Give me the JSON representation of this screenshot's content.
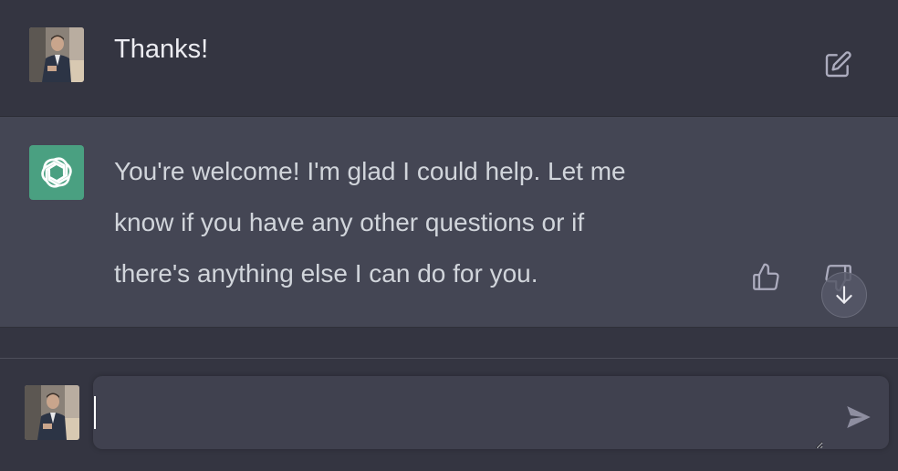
{
  "conversation": {
    "user_message": "Thanks!",
    "assistant_lines": [
      "You're welcome! I'm glad I could help. Let me",
      "know if you have any other questions or if",
      "there's anything else I can do for you."
    ]
  },
  "composer": {
    "value": "",
    "placeholder": ""
  },
  "icons": {
    "edit": "edit-icon",
    "thumbs_up": "thumbs-up-icon",
    "thumbs_down": "thumbs-down-icon",
    "scroll_down": "arrow-down-icon",
    "send": "send-icon",
    "assistant_logo": "openai-logo-icon"
  },
  "colors": {
    "background": "#343541",
    "assistant_background": "#444654",
    "assistant_logo_bg": "#4aa081",
    "composer_bg": "#40414f",
    "text_primary": "#ececf1",
    "text_secondary": "#d1d5db",
    "icon": "#acacbe"
  }
}
